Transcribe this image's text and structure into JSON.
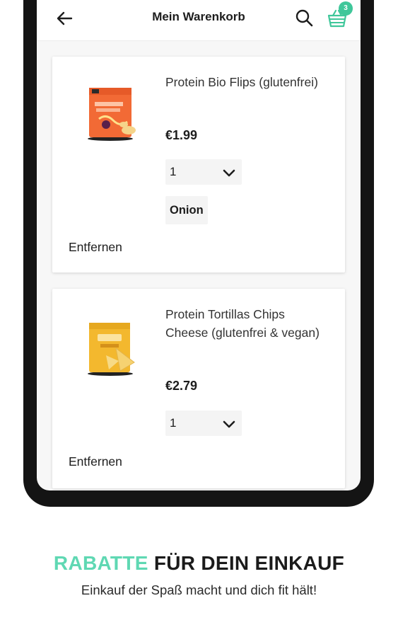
{
  "appbar": {
    "title": "Mein Warenkorb",
    "back_icon": "arrow-left-icon",
    "search_icon": "search-icon",
    "basket_icon": "basket-icon",
    "basket_count": "3",
    "accent_color": "#3fc79a"
  },
  "cart": {
    "items": [
      {
        "name": "Protein Bio Flips (glutenfrei)",
        "price": "€1.99",
        "quantity": "1",
        "variant": "Onion",
        "remove_label": "Entfernen",
        "image": "orange-snack-bag"
      },
      {
        "name": "Protein Tortillas Chips Cheese (glutenfrei & vegan)",
        "price": "€2.79",
        "quantity": "1",
        "remove_label": "Entfernen",
        "image": "yellow-chips-bag"
      }
    ]
  },
  "promo": {
    "headline_accent": "RABATTE",
    "headline_rest": "FÜR DEIN EINKAUF",
    "subline": "Einkauf der Spaß macht und dich fit hält!",
    "accent_color": "#5fd8b3"
  }
}
